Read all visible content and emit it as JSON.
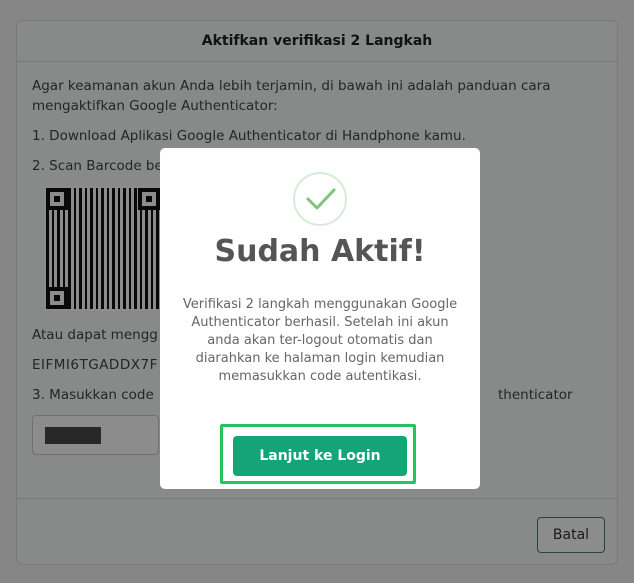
{
  "panel": {
    "title": "Aktifkan verifikasi 2 Langkah",
    "intro": "Agar keamanan akun Anda lebih terjamin, di bawah ini adalah panduan cara mengaktifkan Google Authenticator:",
    "step1": "1. Download Aplikasi Google Authenticator di Handphone kamu.",
    "step2": "2. Scan Barcode be",
    "alt_text": "Atau dapat mengg",
    "secret_code": "EIFMI6TGADDX7F",
    "step3": "3. Masukkan code",
    "step3_tail": "thenticator",
    "cancel_label": "Batal"
  },
  "modal": {
    "icon": "check-icon",
    "title": "Sudah Aktif!",
    "message": "Verifikasi 2 langkah menggunakan Google Authenticator berhasil. Setelah ini akun anda akan ter-logout otomatis dan diarahkan ke halaman login kemudian memasukkan code autentikasi.",
    "button_label": "Lanjut ke Login"
  },
  "colors": {
    "primary": "#13a578",
    "highlight": "#22c55e",
    "check": "#7cc47c"
  }
}
